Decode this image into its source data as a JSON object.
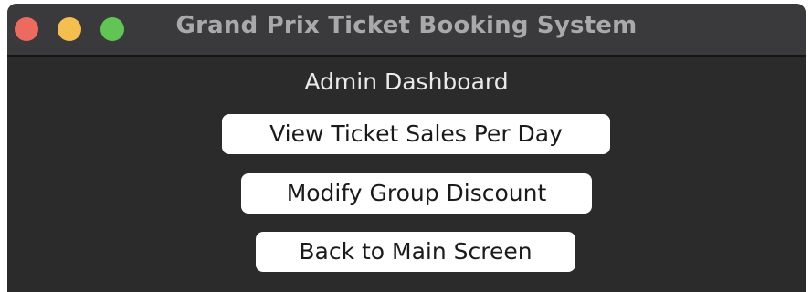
{
  "window": {
    "title": "Grand Prix Ticket Booking System",
    "controls": {
      "close_color": "#ec6a5e",
      "minimize_color": "#f4bf4f",
      "zoom_color": "#61c554"
    }
  },
  "dashboard": {
    "heading": "Admin Dashboard",
    "buttons": [
      {
        "label": "View Ticket Sales Per Day"
      },
      {
        "label": "Modify Group Discount"
      },
      {
        "label": "Back to Main Screen"
      }
    ]
  },
  "colors": {
    "background": "#2b2b2b",
    "titlebar": "#3a3a3c",
    "button": "#ffffff"
  }
}
